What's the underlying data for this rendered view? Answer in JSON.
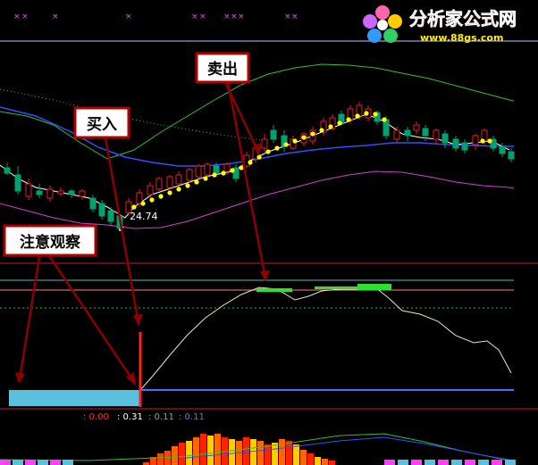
{
  "logo": {
    "name": "分析家公式网",
    "url": "www.88gs.com"
  },
  "annotations": {
    "sell": "卖出",
    "buy": "买入",
    "watch": "注意观察"
  },
  "price_label": "24.74",
  "indicator_readout": [
    {
      "text": ": 0.00",
      "color": "#ff3030"
    },
    {
      "text": ": 0.31",
      "color": "#ffffff"
    },
    {
      "text": ": 0.11",
      "color": "#30e030"
    },
    {
      "text": ": 0.11",
      "color": "#4a7cff"
    }
  ],
  "colors": {
    "candle_up": "#e02020",
    "candle_down": "#00a070",
    "upper_band": "#30c030",
    "mid_band": "#3050ff",
    "lower_band": "#d040d0",
    "signal_dots": "#ffff00",
    "oscillator": "#e8e8c0",
    "watch_bar": "#5bc0de",
    "green_hist": "#30e030",
    "arrow": "#8b0000"
  },
  "chart_data": {
    "type": "candlestick",
    "title": "",
    "xlabel": "",
    "ylabel": "",
    "annotated_low": 24.74,
    "indicator_values": [
      0.0,
      0.31,
      0.11,
      0.11
    ]
  }
}
